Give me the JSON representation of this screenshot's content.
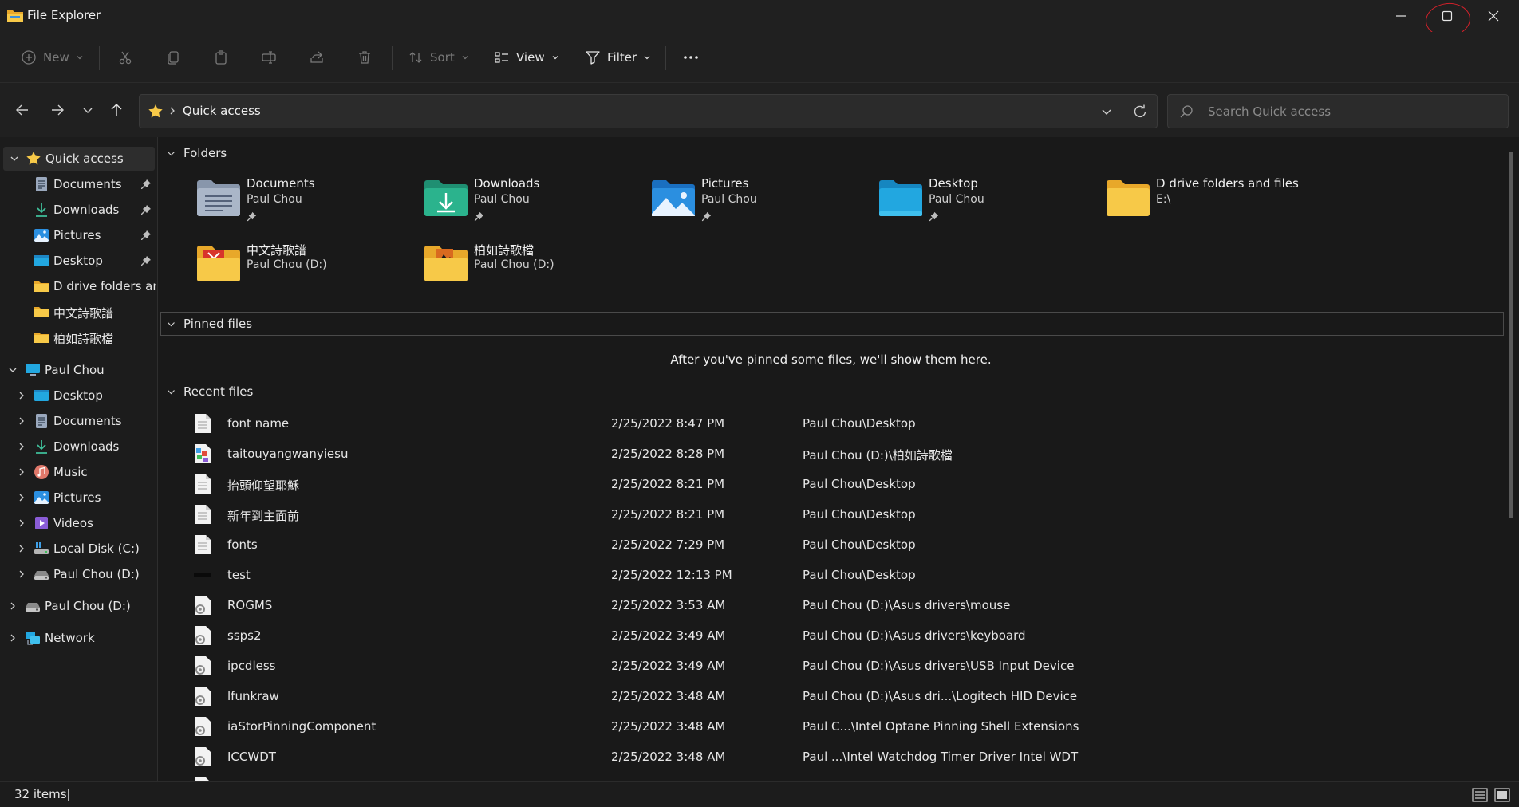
{
  "window": {
    "title": "File Explorer"
  },
  "commandbar": {
    "new_label": "New",
    "sort_label": "Sort",
    "view_label": "View",
    "filter_label": "Filter"
  },
  "address": {
    "crumb": "Quick access"
  },
  "search": {
    "placeholder": "Search Quick access"
  },
  "sidebar": {
    "quick_access": "Quick access",
    "qa_items": [
      "Documents",
      "Downloads",
      "Pictures",
      "Desktop",
      "D drive folders and files",
      "中文詩歌譜",
      "柏如詩歌檔"
    ],
    "pc": "Paul Chou",
    "pc_items": [
      "Desktop",
      "Documents",
      "Downloads",
      "Music",
      "Pictures",
      "Videos",
      "Local Disk (C:)",
      "Paul Chou (D:)"
    ],
    "drive_d": "Paul Chou (D:)",
    "network": "Network"
  },
  "main": {
    "folders_header": "Folders",
    "folders": [
      {
        "name": "Documents",
        "location": "Paul Chou",
        "pinned": true
      },
      {
        "name": "Downloads",
        "location": "Paul Chou",
        "pinned": true
      },
      {
        "name": "Pictures",
        "location": "Paul Chou",
        "pinned": true
      },
      {
        "name": "Desktop",
        "location": "Paul Chou",
        "pinned": true
      },
      {
        "name": "D drive folders and files",
        "location": "E:\\",
        "pinned": false
      },
      {
        "name": "中文詩歌譜",
        "location": "Paul Chou (D:)",
        "pinned": false
      },
      {
        "name": "柏如詩歌檔",
        "location": "Paul Chou (D:)",
        "pinned": false
      }
    ],
    "pinned_header": "Pinned files",
    "pinned_empty": "After you've pinned some files, we'll show them here.",
    "recent_header": "Recent files",
    "recent": [
      {
        "name": "font name",
        "date": "2/25/2022 8:47 PM",
        "location": "Paul Chou\\Desktop"
      },
      {
        "name": "taitouyangwanyiesu",
        "date": "2/25/2022 8:28 PM",
        "location": "Paul Chou (D:)\\柏如詩歌檔"
      },
      {
        "name": "抬頭仰望耶穌",
        "date": "2/25/2022 8:21 PM",
        "location": "Paul Chou\\Desktop"
      },
      {
        "name": "新年到主面前",
        "date": "2/25/2022 8:21 PM",
        "location": "Paul Chou\\Desktop"
      },
      {
        "name": "fonts",
        "date": "2/25/2022 7:29 PM",
        "location": "Paul Chou\\Desktop"
      },
      {
        "name": "test",
        "date": "2/25/2022 12:13 PM",
        "location": "Paul Chou\\Desktop"
      },
      {
        "name": "ROGMS",
        "date": "2/25/2022 3:53 AM",
        "location": "Paul Chou (D:)\\Asus drivers\\mouse"
      },
      {
        "name": "ssps2",
        "date": "2/25/2022 3:49 AM",
        "location": "Paul Chou (D:)\\Asus drivers\\keyboard"
      },
      {
        "name": "ipcdless",
        "date": "2/25/2022 3:49 AM",
        "location": "Paul Chou (D:)\\Asus drivers\\USB Input Device"
      },
      {
        "name": "lfunkraw",
        "date": "2/25/2022 3:48 AM",
        "location": "Paul Chou (D:)\\Asus dri...\\Logitech HID Device"
      },
      {
        "name": "iaStorPinningComponent",
        "date": "2/25/2022 3:48 AM",
        "location": "Paul C...\\Intel Optane Pinning Shell Extensions"
      },
      {
        "name": "ICCWDT",
        "date": "2/25/2022 3:48 AM",
        "location": "Paul ...\\Intel Watchdog Timer Driver Intel WDT"
      }
    ]
  },
  "status": {
    "count": "32 items"
  }
}
